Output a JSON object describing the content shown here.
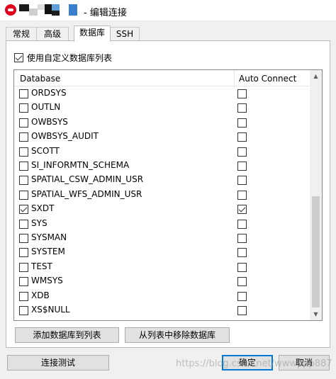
{
  "window": {
    "title": "- 编辑连接"
  },
  "tabs": [
    {
      "label": "常规"
    },
    {
      "label": "高级"
    },
    {
      "label": "数据库"
    },
    {
      "label": "SSH"
    }
  ],
  "use_custom_list": {
    "label": "使用自定义数据库列表",
    "checked": true
  },
  "list": {
    "headers": {
      "database": "Database",
      "auto_connect": "Auto Connect"
    },
    "rows": [
      {
        "name": "ORDSYS",
        "selected": false,
        "auto_connect": false
      },
      {
        "name": "OUTLN",
        "selected": false,
        "auto_connect": false
      },
      {
        "name": "OWBSYS",
        "selected": false,
        "auto_connect": false
      },
      {
        "name": "OWBSYS_AUDIT",
        "selected": false,
        "auto_connect": false
      },
      {
        "name": "SCOTT",
        "selected": false,
        "auto_connect": false
      },
      {
        "name": "SI_INFORMTN_SCHEMA",
        "selected": false,
        "auto_connect": false
      },
      {
        "name": "SPATIAL_CSW_ADMIN_USR",
        "selected": false,
        "auto_connect": false
      },
      {
        "name": "SPATIAL_WFS_ADMIN_USR",
        "selected": false,
        "auto_connect": false
      },
      {
        "name": "SXDT",
        "selected": true,
        "auto_connect": true
      },
      {
        "name": "SYS",
        "selected": false,
        "auto_connect": false
      },
      {
        "name": "SYSMAN",
        "selected": false,
        "auto_connect": false
      },
      {
        "name": "SYSTEM",
        "selected": false,
        "auto_connect": false
      },
      {
        "name": "TEST",
        "selected": false,
        "auto_connect": false
      },
      {
        "name": "WMSYS",
        "selected": false,
        "auto_connect": false
      },
      {
        "name": "XDB",
        "selected": false,
        "auto_connect": false
      },
      {
        "name": "XS$NULL",
        "selected": false,
        "auto_connect": false
      }
    ]
  },
  "buttons": {
    "add_to_list": "添加数据库到列表",
    "remove_from_list": "从列表中移除数据库",
    "test_connection": "连接测试",
    "ok": "确定",
    "cancel": "取消"
  },
  "watermark": "https://blog.csdn.net/wwwppp887",
  "colors": {
    "app_icon": "#e0001b",
    "primary_border": "#0078d7"
  }
}
